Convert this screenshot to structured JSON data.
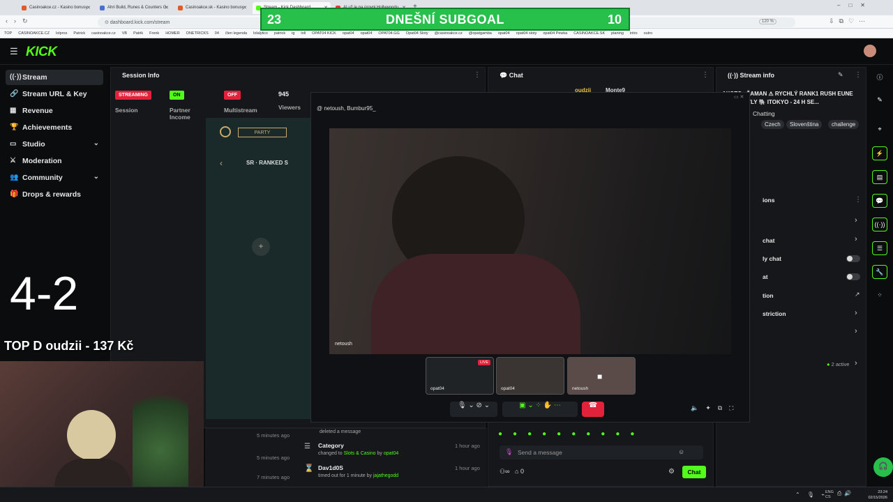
{
  "browser": {
    "tabs": [
      {
        "label": "Casinoakce.cz - Kasino bonusy",
        "color": "#e05a2b"
      },
      {
        "label": "Ahri Build, Runes & Counters G",
        "color": "#4a6fd1"
      },
      {
        "label": "Casinoakce.sk - Kasino bonusy",
        "color": "#e05a2b"
      },
      {
        "label": "Stream - Kick Dashboard",
        "color": "#53fc18"
      },
      {
        "label": "AI už je na úrovni Hollywoodu",
        "color": "#e53935"
      }
    ],
    "url": "dashboard.kick.com/stream",
    "zoom": "120 %",
    "bookmarks": [
      "TOP",
      "CASINOAKCE.CZ",
      "lolpros",
      "Patrick",
      "casinoakce.cz",
      "VB",
      "Patrik",
      "Frenk",
      "HOMER",
      "ONETRICKS",
      "04",
      "člen legenda",
      "lolalytics",
      "patrick",
      "ig",
      "loll",
      "OPAT04 KICK",
      "opat04",
      "opat04",
      "OPAT04.GG",
      "Opat04 Sloty",
      "@casinoakce.cz",
      "@opatgamba",
      "opat04",
      "opat04 sloty",
      "opat04 Pewka",
      "CASINOAKCE.SK",
      "planing",
      "intro",
      "outro"
    ]
  },
  "subgoal": {
    "left": "23",
    "title": "DNEŠNÍ SUBGOAL",
    "right": "10"
  },
  "kick": {
    "logo": "KICK"
  },
  "sidebar": {
    "items": [
      {
        "label": "Stream",
        "icon": "broadcast-icon"
      },
      {
        "label": "Stream URL & Key",
        "icon": "link-icon"
      },
      {
        "label": "Revenue",
        "icon": "revenue-icon"
      },
      {
        "label": "Achievements",
        "icon": "trophy-icon"
      },
      {
        "label": "Studio",
        "icon": "studio-icon"
      },
      {
        "label": "Moderation",
        "icon": "sword-icon"
      },
      {
        "label": "Community",
        "icon": "people-icon"
      },
      {
        "label": "Drops & rewards",
        "icon": "gift-icon"
      }
    ]
  },
  "session": {
    "title": "Session Info",
    "streaming_badge": "STREAMING",
    "session_label": "Session",
    "on_badge": "ON",
    "partner_label": "Partner Income",
    "off_badge": "OFF",
    "multistream_label": "Multistream",
    "viewers_value": "945",
    "viewers_label": "Viewers"
  },
  "game": {
    "party": "PARTY",
    "ranked": "SR · RANKED S",
    "plus": "+"
  },
  "chat": {
    "title": "Chat",
    "users": [
      "oudzii",
      "Monte9"
    ],
    "placeholder": "Send a message",
    "send_label": "Chat",
    "count": "0"
  },
  "stream_info": {
    "title": "Stream info",
    "stream_title": "AXOTO...ŠAMAN ⚠ RYCHLÝ RANK1 RUSH EUNE TOČKY BYLY 🐘 ITOKYO - 24 H SE...",
    "category": "Chatting",
    "tags": [
      "Czech",
      "Slovenština",
      "challenge"
    ]
  },
  "settings": {
    "title": "ions",
    "rows": [
      "chat",
      "ly chat",
      "at",
      "tion",
      "striction",
      ""
    ],
    "active": "2 active"
  },
  "overlay": {
    "participants": "netoush, Bumbur95_",
    "video_name": "netoush",
    "thumbs": [
      "opat04",
      "opat04",
      "netoush"
    ],
    "live_label": "LIVE"
  },
  "activity": {
    "times": [
      "5 minutes ago",
      "5 minutes ago",
      "7 minutes ago"
    ],
    "deleted": "deleted a message",
    "category_title": "Category",
    "category_desc_prefix": "changed to",
    "category_value": "Slots & Casino",
    "category_by": "by",
    "category_user": "opat04",
    "category_time": "1 hour ago",
    "timeout_user": "Dav1d0S",
    "timeout_desc": "timed out for 1 minute by",
    "timeout_by": "jajathegodd",
    "timeout_time": "1 hour ago"
  },
  "stream_overlay": {
    "score": "4-2",
    "ticker": "TOP D  oudzii - 137 Kč"
  },
  "taskbar": {
    "lang": "ENG\nCS",
    "time": "23:24",
    "date": "02/15/2026"
  },
  "colors": {
    "accent": "#53fc18",
    "streaming": "#e2223a",
    "panel": "#15171a",
    "bg": "#0b0c0e"
  }
}
